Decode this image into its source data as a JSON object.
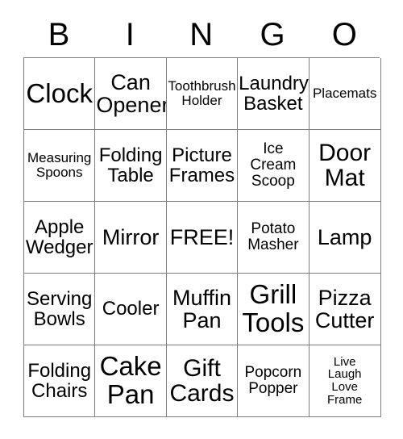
{
  "card": {
    "header_letters": [
      "B",
      "I",
      "N",
      "G",
      "O"
    ],
    "free_space_label": "FREE!",
    "colors": {
      "background": "#ffffff",
      "grid_line": "#7f7f7f",
      "text": "#000000"
    },
    "rows": [
      [
        {
          "label": "Clock",
          "size": "xxl"
        },
        {
          "label": "Can\nOpener",
          "size": "lg"
        },
        {
          "label": "Toothbrush\nHolder",
          "size": "xs"
        },
        {
          "label": "Laundry\nBasket",
          "size": "md"
        },
        {
          "label": "Placemats",
          "size": "xs"
        }
      ],
      [
        {
          "label": "Measuring\nSpoons",
          "size": "xs"
        },
        {
          "label": "Folding\nTable",
          "size": "md"
        },
        {
          "label": "Picture\nFrames",
          "size": "md"
        },
        {
          "label": "Ice\nCream\nScoop",
          "size": "sm"
        },
        {
          "label": "Door\nMat",
          "size": "xl"
        }
      ],
      [
        {
          "label": "Apple\nWedger",
          "size": "md"
        },
        {
          "label": "Mirror",
          "size": "lg"
        },
        {
          "label": "FREE!",
          "size": "lg"
        },
        {
          "label": "Potato\nMasher",
          "size": "sm"
        },
        {
          "label": "Lamp",
          "size": "lg"
        }
      ],
      [
        {
          "label": "Serving\nBowls",
          "size": "md"
        },
        {
          "label": "Cooler",
          "size": "md"
        },
        {
          "label": "Muffin\nPan",
          "size": "lg"
        },
        {
          "label": "Grill\nTools",
          "size": "xxl"
        },
        {
          "label": "Pizza\nCutter",
          "size": "lg"
        }
      ],
      [
        {
          "label": "Folding\nChairs",
          "size": "md"
        },
        {
          "label": "Cake\nPan",
          "size": "xxl"
        },
        {
          "label": "Gift\nCards",
          "size": "xl"
        },
        {
          "label": "Popcorn\nPopper",
          "size": "sm"
        },
        {
          "label": "Live\nLaugh\nLove\nFrame",
          "size": "xxs"
        }
      ]
    ]
  }
}
